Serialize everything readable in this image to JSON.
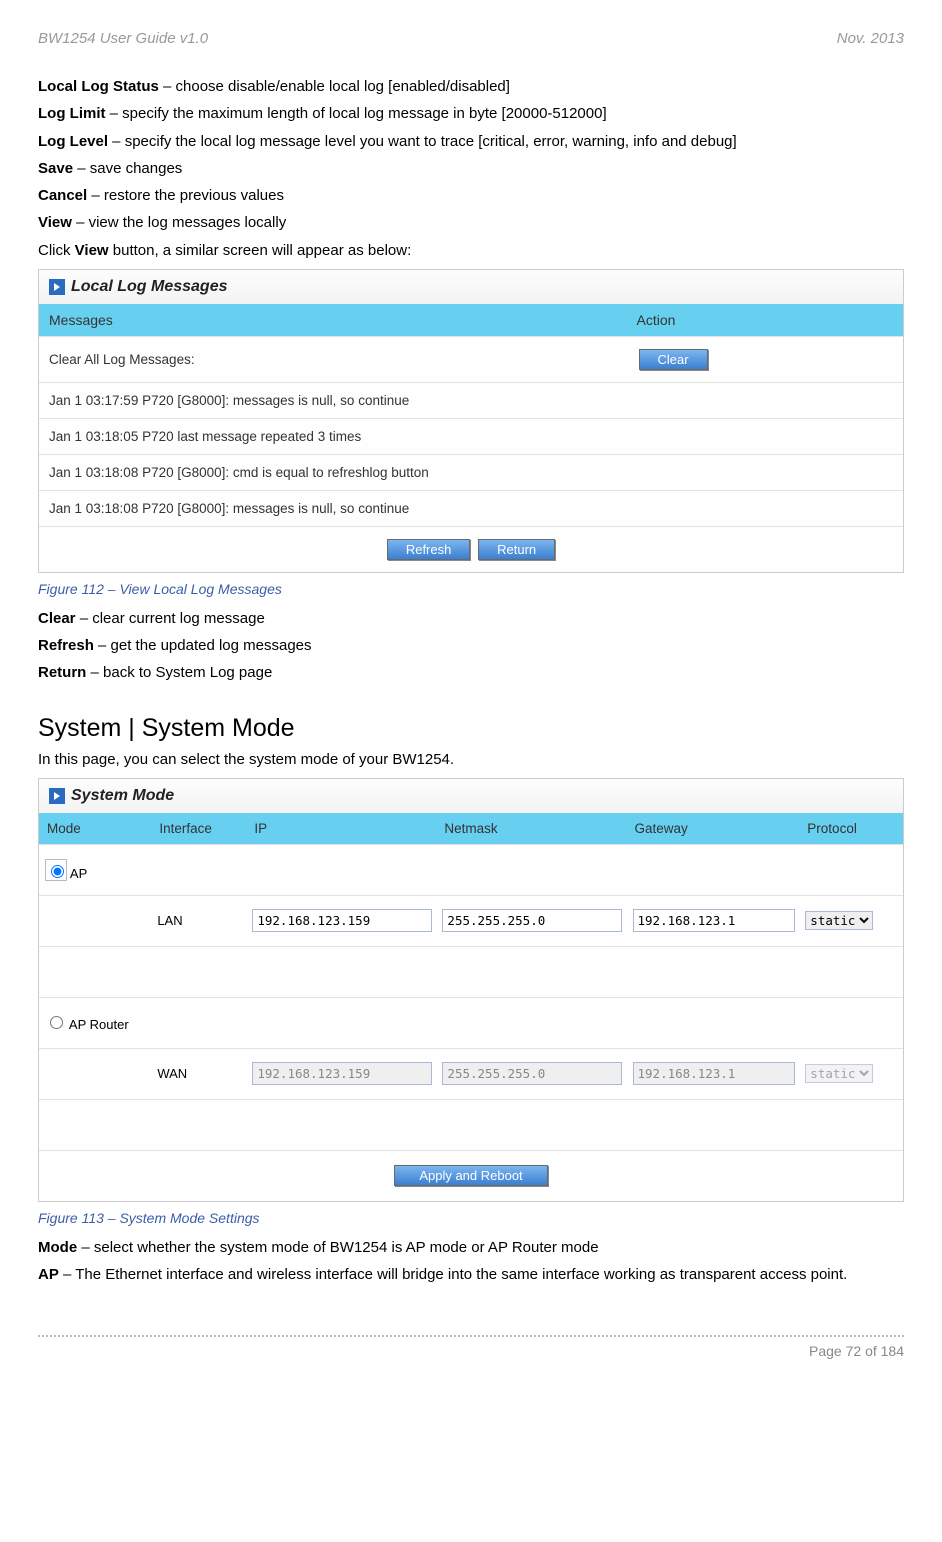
{
  "header": {
    "left": "BW1254 User Guide v1.0",
    "right": "Nov.  2013"
  },
  "intro": [
    {
      "bold": "Local Log Status",
      "text": " – choose disable/enable local log [enabled/disabled]"
    },
    {
      "bold": "Log Limit",
      "text": " – specify the maximum length of local log message in byte [20000-512000]"
    },
    {
      "bold": "Log Level",
      "text": " – specify the local log message level you want to trace [critical, error, warning, info and debug]"
    },
    {
      "bold": "Save",
      "text": " – save changes"
    },
    {
      "bold": "Cancel",
      "text": " – restore the previous values"
    },
    {
      "bold": "View",
      "text": " – view the log messages locally"
    }
  ],
  "click_view_prefix": "Click ",
  "click_view_bold": "View",
  "click_view_suffix": " button, a similar screen will appear as below:",
  "log_panel": {
    "title": "Local Log Messages",
    "headers": {
      "messages": "Messages",
      "action": "Action"
    },
    "clear_row_label": "Clear All Log Messages:",
    "rows": [
      "Jan 1 03:17:59 P720 [G8000]: messages is null, so continue",
      "Jan 1 03:18:05 P720 last message repeated 3 times",
      "Jan 1 03:18:08 P720 [G8000]: cmd is equal to refreshlog button",
      "Jan 1 03:18:08 P720 [G8000]: messages is null, so continue"
    ],
    "buttons": {
      "clear": "Clear",
      "refresh": "Refresh",
      "return": "Return"
    }
  },
  "figure112": "Figure 112 – View Local Log Messages",
  "after_log": [
    {
      "bold": "Clear",
      "text": " – clear current log message"
    },
    {
      "bold": "Refresh",
      "text": " – get the updated log messages"
    },
    {
      "bold": "Return",
      "text": " – back to System Log page"
    }
  ],
  "section_title": "System | System Mode",
  "section_intro": "In this page, you can select the system mode of your BW1254.",
  "mode_panel": {
    "title": "System Mode",
    "headers": {
      "mode": "Mode",
      "interface": "Interface",
      "ip": "IP",
      "netmask": "Netmask",
      "gateway": "Gateway",
      "protocol": "Protocol"
    },
    "rows": {
      "ap": {
        "label": "AP",
        "checked": true,
        "interface": "LAN",
        "ip": "192.168.123.159",
        "netmask": "255.255.255.0",
        "gateway": "192.168.123.1",
        "protocol": "static",
        "disabled": false
      },
      "aprouter": {
        "label": "AP Router",
        "checked": false,
        "interface": "WAN",
        "ip": "192.168.123.159",
        "netmask": "255.255.255.0",
        "gateway": "192.168.123.1",
        "protocol": "static",
        "disabled": true
      }
    },
    "apply_button": "Apply and Reboot"
  },
  "figure113": "Figure 113 – System Mode Settings",
  "after_mode": {
    "mode_line_bold": "Mode",
    "mode_line_text": " – select whether the system mode of BW1254 is AP mode or AP Router mode",
    "ap_bold": "AP",
    "ap_text": " – The Ethernet interface and wireless interface will bridge into the same interface working as transparent access point."
  },
  "footer": "Page 72 of 184"
}
